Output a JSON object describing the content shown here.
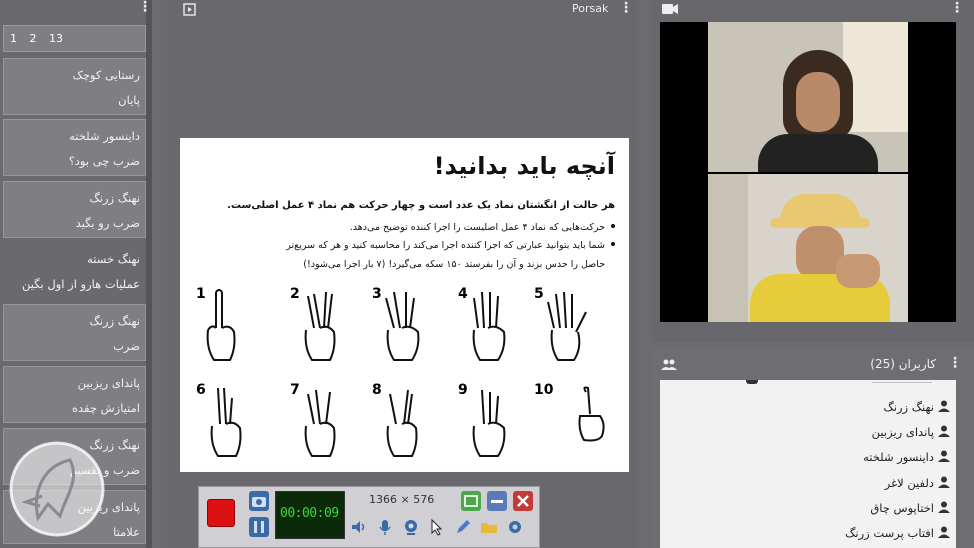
{
  "chat": {
    "pages": [
      "1",
      "2",
      "13"
    ],
    "messages": [
      {
        "user": "رستایی کوچک",
        "text": "پایان"
      },
      {
        "user": "داینسور شلخته",
        "text": "ضرب چی بود؟"
      },
      {
        "user": "نهنگ زرنگ",
        "text": "ضرب رو بگید"
      },
      {
        "user": "نهنگ خسته",
        "text": "عملیات هارو از اول بگین"
      },
      {
        "user": "نهنگ زرنگ",
        "text": "ضرب"
      },
      {
        "user": "پاندای ریزبین",
        "text": "امتیازش چقده"
      },
      {
        "user": "نهنگ زرنگ",
        "text": "ضرب و تقسیم"
      },
      {
        "user": "پاندای ریزبین",
        "text": "علامتا"
      }
    ]
  },
  "content": {
    "title": "Porsak",
    "slide": {
      "title": "آنچه باید بدانید!",
      "intro": "هر حالت از انگشتان نماد یک عدد است و چهار حرکت هم نماد ۴ عمل اصلی‌ست.",
      "bullets": [
        "حرکت‌هایی که نماد ۴ عمل اصلیست را اجرا کننده توضیح می‌دهد.",
        "شما باید بتوانید عبارتی که اجرا کننده اجرا می‌کند را محاسبه کنید و هر که سریع‌تر"
      ],
      "continuation": "حاصل را حدس بزند و آن را بفرستد ۱۵۰ سکه می‌گیرد! (۷ بار اجرا می‌شود!)",
      "numbers": [
        "1",
        "2",
        "3",
        "4",
        "5",
        "6",
        "7",
        "8",
        "9",
        "10"
      ]
    }
  },
  "recorder": {
    "time": "00:00:09",
    "resolution": "1366 × 576"
  },
  "users": {
    "header": "کاربران (25)",
    "list": [
      "نهنگ زرنگ",
      "پاندای ریزبین",
      "داینسور شلخته",
      "دلفین لاغر",
      "اختاپوس چاق",
      "افتاب پرست زرنگ"
    ]
  },
  "colors": {
    "panel": "#6b6b6f",
    "record": "#dd1111",
    "lcd": "#0a2a0a",
    "lcd_text": "#3ad83a"
  }
}
